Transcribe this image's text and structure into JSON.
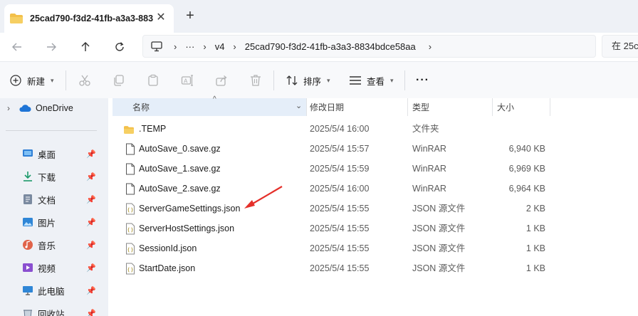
{
  "tab": {
    "title": "25cad790-f3d2-41fb-a3a3-883",
    "close": "✕",
    "new_tab": "+"
  },
  "address": {
    "more": "···",
    "crumbs": [
      "v4",
      "25cad790-f3d2-41fb-a3a3-8834bdce58aa"
    ],
    "search_placeholder": "在 25c"
  },
  "toolbar": {
    "new_label": "新建",
    "sort_label": "排序",
    "view_label": "查看",
    "more_label": "···"
  },
  "sidebar": {
    "onedrive": "OneDrive",
    "items": [
      {
        "label": "桌面",
        "icon": "desktop-icon",
        "color": "#2f7fd6"
      },
      {
        "label": "下载",
        "icon": "download-icon",
        "color": "#1c9a6b"
      },
      {
        "label": "文档",
        "icon": "document-icon",
        "color": "#7a8aa0"
      },
      {
        "label": "图片",
        "icon": "pictures-icon",
        "color": "#2f86d6"
      },
      {
        "label": "音乐",
        "icon": "music-icon",
        "color": "#e0634a"
      },
      {
        "label": "视频",
        "icon": "video-icon",
        "color": "#8a4fd0"
      },
      {
        "label": "此电脑",
        "icon": "computer-icon",
        "color": "#2f86d6"
      },
      {
        "label": "回收站",
        "icon": "recycle-bin-icon",
        "color": "#6a7a90"
      }
    ]
  },
  "columns": {
    "name": "名称",
    "modified": "修改日期",
    "type": "类型",
    "size": "大小"
  },
  "files": [
    {
      "name": ".TEMP",
      "modified": "2025/5/4 16:00",
      "type": "文件夹",
      "size": "",
      "icon": "folder-icon"
    },
    {
      "name": "AutoSave_0.save.gz",
      "modified": "2025/5/4 15:57",
      "type": "WinRAR",
      "size": "6,940 KB",
      "icon": "file-icon"
    },
    {
      "name": "AutoSave_1.save.gz",
      "modified": "2025/5/4 15:59",
      "type": "WinRAR",
      "size": "6,969 KB",
      "icon": "file-icon"
    },
    {
      "name": "AutoSave_2.save.gz",
      "modified": "2025/5/4 16:00",
      "type": "WinRAR",
      "size": "6,964 KB",
      "icon": "file-icon"
    },
    {
      "name": "ServerGameSettings.json",
      "modified": "2025/5/4 15:55",
      "type": "JSON 源文件",
      "size": "2 KB",
      "icon": "json-file-icon"
    },
    {
      "name": "ServerHostSettings.json",
      "modified": "2025/5/4 15:55",
      "type": "JSON 源文件",
      "size": "1 KB",
      "icon": "json-file-icon"
    },
    {
      "name": "SessionId.json",
      "modified": "2025/5/4 15:55",
      "type": "JSON 源文件",
      "size": "1 KB",
      "icon": "json-file-icon"
    },
    {
      "name": "StartDate.json",
      "modified": "2025/5/4 15:55",
      "type": "JSON 源文件",
      "size": "1 KB",
      "icon": "json-file-icon"
    }
  ],
  "colors": {
    "accent": "#0067c0",
    "selected_header": "#e5eef9",
    "folder": "#f3c04a",
    "annotation_arrow": "#e5302a"
  }
}
